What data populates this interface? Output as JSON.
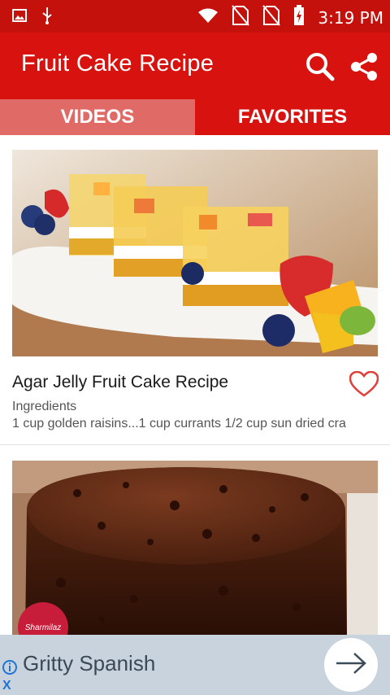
{
  "status_bar": {
    "time": "3:19 PM",
    "icons": [
      "image-icon",
      "usb-icon",
      "wifi-icon",
      "no-sim-icon",
      "no-sim-icon",
      "battery-charging-icon"
    ]
  },
  "app_bar": {
    "title": "Fruit Cake Recipe",
    "icons": [
      "search-icon",
      "share-icon"
    ],
    "color": "#d8130f"
  },
  "tabs": [
    {
      "label": "VIDEOS",
      "active": false
    },
    {
      "label": "FAVORITES",
      "active": true
    }
  ],
  "recipes": [
    {
      "title": "Agar Jelly Fruit Cake Recipe",
      "subtitle": "Ingredients",
      "description": "1 cup golden raisins...1 cup currants 1/2 cup sun dried cra",
      "favorite_icon": "heart-outline-icon"
    },
    {
      "title": "",
      "logo_text": "Sharmilaz"
    }
  ],
  "ad": {
    "text": "Gritty Spanish",
    "close_label": "X",
    "icons": [
      "info-icon",
      "arrow-right-icon"
    ]
  }
}
